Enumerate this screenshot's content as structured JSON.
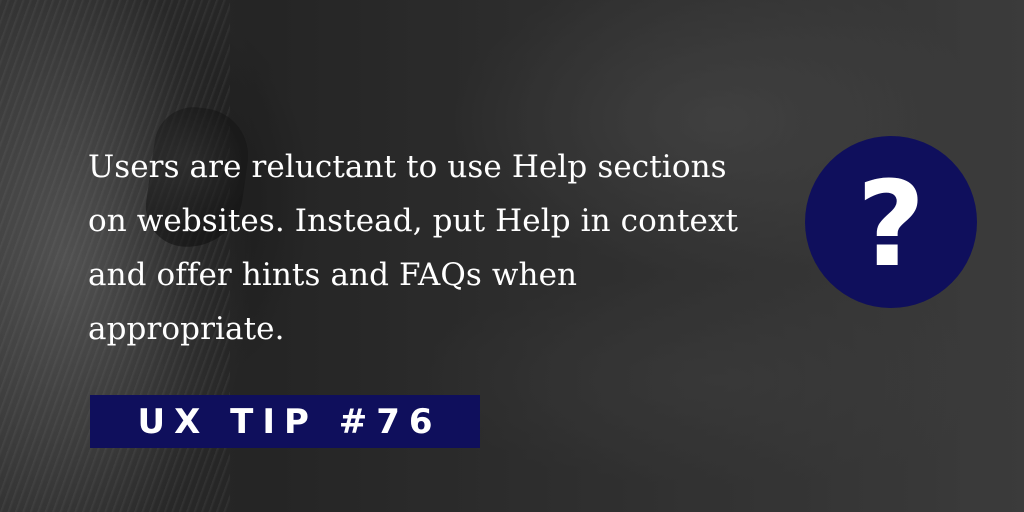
{
  "tip": {
    "text_lines": [
      "Users are reluctant to use Help sections",
      "on websites. Instead, put Help in context",
      "and offer hints and FAQs when",
      "appropriate."
    ]
  },
  "badge": {
    "label": "UX TIP #76"
  },
  "help_icon": {
    "glyph": "?"
  },
  "colors": {
    "brand_navy": "#0f0f5c",
    "text_white": "#ffffff"
  }
}
